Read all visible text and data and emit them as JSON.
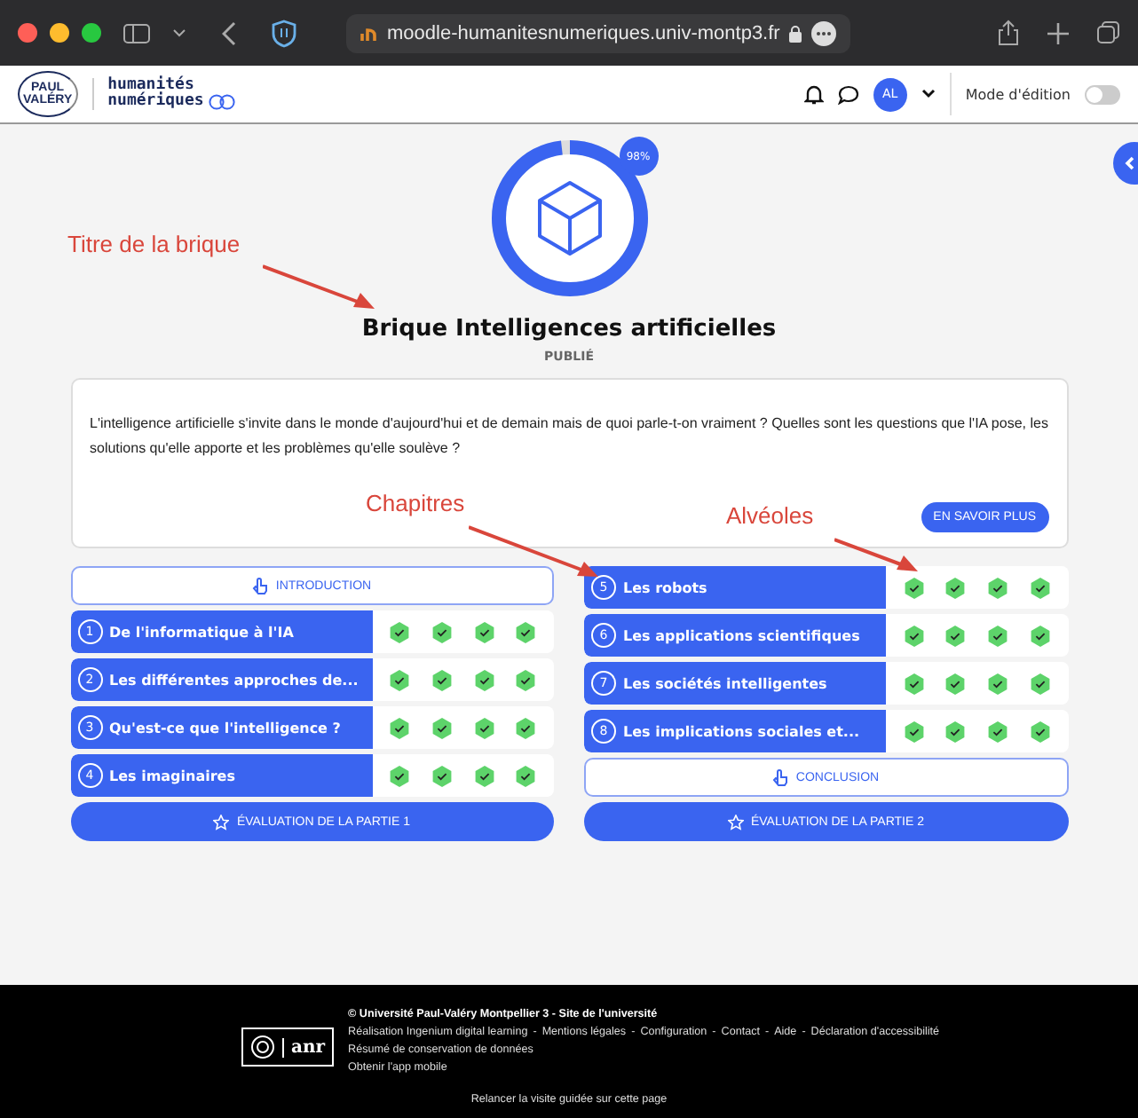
{
  "browser": {
    "url": "moodle-humanitesnumeriques.univ-montp3.fr"
  },
  "header": {
    "logo_lines": [
      "PAUL",
      "VALÉRY"
    ],
    "site_name": [
      "humanités",
      "numériques"
    ],
    "avatar": "AL",
    "edit_mode": {
      "label": "Mode d'édition",
      "on": false
    }
  },
  "brick": {
    "progress": {
      "level": 0.98,
      "label": "98%"
    },
    "title": "Brique Intelligences artificielles",
    "status": "PUBLIÉ",
    "description": "L'intelligence artificielle s'invite dans le monde d'aujourd'hui et de demain mais de quoi parle-t-on vraiment ? Quelles sont les questions que l'IA pose, les solutions qu'elle apporte et les problèmes qu'elle soulève ?",
    "more_button": "EN SAVOIR PLUS"
  },
  "parts": [
    {
      "intro": "INTRODUCTION",
      "chapters": [
        {
          "number": "1",
          "title": "De l'informatique à l'IA",
          "alveoles": [
            {
              "done": true
            },
            {
              "done": true
            },
            {
              "done": true
            },
            {
              "done": true
            }
          ]
        },
        {
          "number": "2",
          "title": "Les différentes approches de...",
          "alveoles": [
            {
              "done": true
            },
            {
              "done": true
            },
            {
              "done": true
            },
            {
              "done": true
            }
          ]
        },
        {
          "number": "3",
          "title": "Qu'est-ce que l'intelligence ?",
          "alveoles": [
            {
              "done": true
            },
            {
              "done": true
            },
            {
              "done": true
            },
            {
              "done": true
            }
          ]
        },
        {
          "number": "4",
          "title": "Les imaginaires",
          "alveoles": [
            {
              "done": true
            },
            {
              "done": true
            },
            {
              "done": true
            },
            {
              "done": true
            }
          ]
        }
      ],
      "evaluation": "ÉVALUATION DE LA PARTIE 1"
    },
    {
      "conclusion": "CONCLUSION",
      "chapters": [
        {
          "number": "5",
          "title": "Les robots",
          "alveoles": [
            {
              "done": true
            },
            {
              "done": true
            },
            {
              "done": true
            },
            {
              "done": true
            }
          ]
        },
        {
          "number": "6",
          "title": "Les applications scientifiques",
          "alveoles": [
            {
              "done": true
            },
            {
              "done": true
            },
            {
              "done": true
            },
            {
              "done": true
            }
          ]
        },
        {
          "number": "7",
          "title": "Les sociétés intelligentes",
          "alveoles": [
            {
              "done": true
            },
            {
              "done": true
            },
            {
              "done": true
            },
            {
              "done": true
            }
          ]
        },
        {
          "number": "8",
          "title": "Les implications sociales et...",
          "alveoles": [
            {
              "done": true
            },
            {
              "done": true
            },
            {
              "done": true
            },
            {
              "done": true
            }
          ]
        }
      ],
      "evaluation": "ÉVALUATION DE LA PARTIE 2"
    }
  ],
  "annotations": [
    "Titre de la brique",
    "Chapitres",
    "Alvéoles"
  ],
  "footer": {
    "copyright": "© Université Paul-Valéry Montpellier 3 - Site de l'université",
    "link_separator": "-",
    "links": [
      "Réalisation Ingenium digital learning",
      "Mentions légales",
      "Configuration",
      "Contact",
      "Aide",
      "Déclaration d'accessibilité"
    ],
    "lines": [
      "Résumé de conservation de données",
      "Obtenir l'app mobile"
    ],
    "tour": "Relancer la visite guidée sur cette page",
    "anr": "anr"
  }
}
